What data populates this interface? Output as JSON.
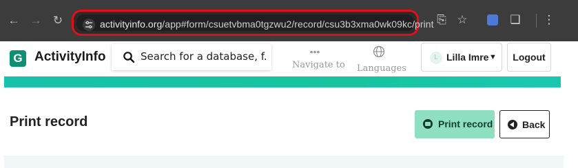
{
  "browser": {
    "url_host": "activityinfo.org",
    "url_path": "/app#form/csuetvbma0tgzwu2/record/csu3b3xma0wk09kc/print",
    "icons": [
      "back-arrow",
      "forward-arrow",
      "reload",
      "site-settings",
      "cast",
      "bookmark-star",
      "extension",
      "puzzle",
      "menu-kebab"
    ]
  },
  "header": {
    "brand": "ActivityInfo",
    "logo_letter": "G",
    "search_placeholder": "Search for a database, f...",
    "navigate_label": "Navigate to",
    "languages_label": "Languages",
    "user_name": "Lilla Imre",
    "user_initial": "L",
    "logout_label": "Logout"
  },
  "page": {
    "title": "Print record",
    "print_label": "Print record",
    "back_label": "Back"
  },
  "colors": {
    "accent": "#18c2ab",
    "print_button": "#8fe0c1",
    "highlight_box": "#e0101a"
  }
}
